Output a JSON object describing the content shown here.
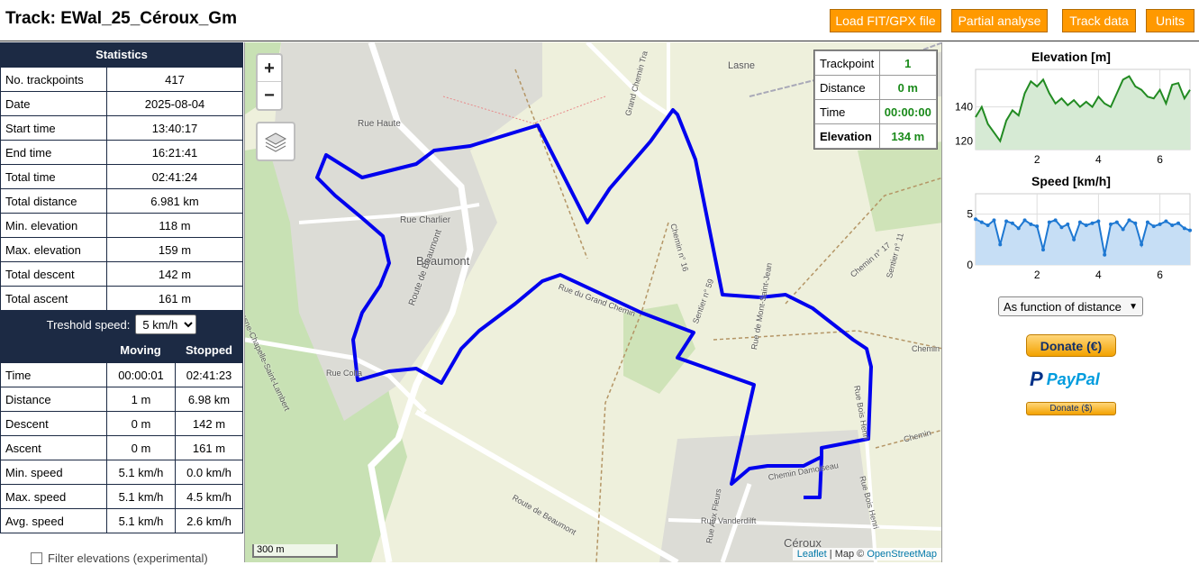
{
  "header": {
    "title": "Track: EWal_25_Céroux_Gm",
    "buttons": [
      "Load FIT/GPX file",
      "Partial analyse",
      "Track data",
      "Units"
    ]
  },
  "stats": {
    "title": "Statistics",
    "rows": [
      {
        "label": "No. trackpoints",
        "value": "417"
      },
      {
        "label": "Date",
        "value": "2025-08-04"
      },
      {
        "label": "Start time",
        "value": "13:40:17"
      },
      {
        "label": "End time",
        "value": "16:21:41"
      },
      {
        "label": "Total time",
        "value": "02:41:24"
      },
      {
        "label": "Total distance",
        "value": "6.981 km"
      },
      {
        "label": "Min. elevation",
        "value": "118 m"
      },
      {
        "label": "Max. elevation",
        "value": "159 m"
      },
      {
        "label": "Total descent",
        "value": "142 m"
      },
      {
        "label": "Total ascent",
        "value": "161 m"
      }
    ],
    "threshold_label": "Treshold speed:",
    "threshold_value": "5 km/h",
    "moving_header": "Moving",
    "stopped_header": "Stopped",
    "moving_rows": [
      {
        "label": "Time",
        "moving": "00:00:01",
        "stopped": "02:41:23"
      },
      {
        "label": "Distance",
        "moving": "1 m",
        "stopped": "6.98 km"
      },
      {
        "label": "Descent",
        "moving": "0 m",
        "stopped": "142 m"
      },
      {
        "label": "Ascent",
        "moving": "0 m",
        "stopped": "161 m"
      },
      {
        "label": "Min. speed",
        "moving": "5.1 km/h",
        "stopped": "0.0 km/h"
      },
      {
        "label": "Max. speed",
        "moving": "5.1 km/h",
        "stopped": "4.5 km/h"
      },
      {
        "label": "Avg. speed",
        "moving": "5.1 km/h",
        "stopped": "2.6 km/h"
      }
    ],
    "filter_label": "Filter elevations (experimental)"
  },
  "map": {
    "zoom_in": "+",
    "zoom_out": "−",
    "scale": "300 m",
    "attribution_leaflet": "Leaflet",
    "attribution_map": "| Map ©",
    "attribution_osm": "OpenStreetMap",
    "labels": [
      "Beaumont",
      "Céroux",
      "Lasne",
      "Rue Haute",
      "Rue Charlier",
      "Route de Beaumont",
      "Rue Colta",
      "Lasne-Chapelle-Saint-Lambert",
      "Chemin n° 16",
      "Chemin n° 17",
      "Sentier n° 11",
      "Sentier n° 59",
      "Rue de Mont-Saint-Jean",
      "Grand Chemin Tra",
      "Route de Beaumont",
      "Chemin Damoiseau",
      "Rue Vanderdilft",
      "Rue Bois Henri",
      "Rue Bois Henri",
      "Rue Aux Fleurs",
      "Rue du Grand Chemin",
      "Chemin",
      "Chemin"
    ],
    "route_color": "#0000ee",
    "info": [
      {
        "label": "Trackpoint",
        "value": "1"
      },
      {
        "label": "Distance",
        "value": "0 m"
      },
      {
        "label": "Time",
        "value": "00:00:00"
      },
      {
        "label": "Elevation",
        "value": "134 m"
      }
    ]
  },
  "charts": {
    "function_select": "As function of distance",
    "donate_euro": "Donate (€)",
    "paypal": "PayPal",
    "donate_dollar": "Donate ($)"
  },
  "chart_data": [
    {
      "type": "line",
      "title": "Elevation [m]",
      "xlabel": "",
      "ylabel": "",
      "x_ticks": [
        2,
        4,
        6
      ],
      "y_ticks": [
        120,
        140
      ],
      "xlim": [
        0,
        6.98
      ],
      "ylim": [
        115,
        162
      ],
      "color": "#228b22",
      "x": [
        0,
        0.2,
        0.4,
        0.6,
        0.8,
        1.0,
        1.2,
        1.4,
        1.6,
        1.8,
        2.0,
        2.2,
        2.4,
        2.6,
        2.8,
        3.0,
        3.2,
        3.4,
        3.6,
        3.8,
        4.0,
        4.2,
        4.4,
        4.6,
        4.8,
        5.0,
        5.2,
        5.4,
        5.6,
        5.8,
        6.0,
        6.2,
        6.4,
        6.6,
        6.8,
        6.98
      ],
      "y": [
        134,
        140,
        130,
        125,
        120,
        132,
        138,
        135,
        148,
        155,
        152,
        156,
        148,
        142,
        145,
        141,
        144,
        140,
        143,
        140,
        146,
        142,
        140,
        148,
        156,
        158,
        152,
        150,
        146,
        145,
        150,
        142,
        153,
        154,
        145,
        150
      ]
    },
    {
      "type": "scatter",
      "title": "Speed [km/h]",
      "xlabel": "",
      "ylabel": "",
      "x_ticks": [
        2,
        4,
        6
      ],
      "y_ticks": [
        0,
        5
      ],
      "xlim": [
        0,
        6.98
      ],
      "ylim": [
        0,
        7
      ],
      "color": "#1e78d2",
      "x": [
        0,
        0.2,
        0.4,
        0.6,
        0.8,
        1.0,
        1.2,
        1.4,
        1.6,
        1.8,
        2.0,
        2.2,
        2.4,
        2.6,
        2.8,
        3.0,
        3.2,
        3.4,
        3.6,
        3.8,
        4.0,
        4.2,
        4.4,
        4.6,
        4.8,
        5.0,
        5.2,
        5.4,
        5.6,
        5.8,
        6.0,
        6.2,
        6.4,
        6.6,
        6.8,
        6.98
      ],
      "y": [
        4.5,
        4.2,
        3.9,
        4.4,
        2.0,
        4.3,
        4.1,
        3.6,
        4.4,
        4.0,
        3.8,
        1.5,
        4.2,
        4.4,
        3.7,
        4.0,
        2.5,
        4.2,
        3.9,
        4.1,
        4.3,
        1.0,
        4.0,
        4.2,
        3.5,
        4.4,
        4.1,
        2.0,
        4.2,
        3.8,
        4.0,
        4.3,
        3.9,
        4.1,
        3.6,
        3.4
      ]
    }
  ]
}
